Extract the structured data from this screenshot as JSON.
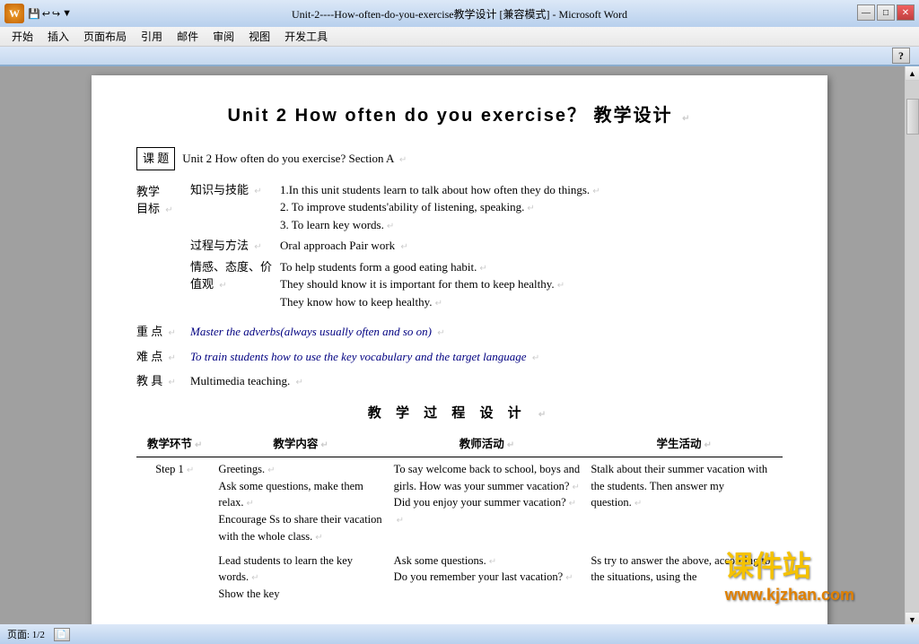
{
  "titlebar": {
    "title": "Unit-2----How-often-do-you-exercise教学设计 [兼容模式] - Microsoft Word",
    "minimize": "—",
    "maximize": "□",
    "close": "✕"
  },
  "quickaccess": {
    "save": "💾",
    "undo": "↩",
    "redo": "↪",
    "dropdown": "▼"
  },
  "menubar": {
    "items": [
      "开始",
      "插入",
      "页面布局",
      "引用",
      "邮件",
      "审阅",
      "视图",
      "开发工具"
    ]
  },
  "document": {
    "title": "Unit 2    How often do you exercise？  教学设计",
    "keti_label": "课  题",
    "keti_content": "Unit 2   How often do you exercise? Section A",
    "jiaoxue_label": "教学\n目标",
    "zhishi_label": "知识与技能",
    "zhishi_items": [
      "1.In this unit students learn to talk about how often they do things.",
      "2. To improve students'ability of listening, speaking.",
      "3. To learn key words."
    ],
    "guocheng_label": "过程与方法",
    "guocheng_content": "Oral approach Pair work",
    "qinggan_label": "情感、态度、价值观",
    "qinggan_items": [
      "To help students form a good eating habit.",
      "They should know it is important for them to keep healthy.",
      "They know how to keep healthy."
    ],
    "zhongdian_label": "重 点",
    "zhongdian_content": "Master the adverbs(always usually often and so on)",
    "nandian_label": "难 点",
    "nandian_content": "To train students how to use the key vocabulary and the target language",
    "jiaoju_label": "教   具",
    "jiaoju_content": "Multimedia teaching.",
    "process_title": "教 学 过 程 设 计",
    "table_headers": [
      "教学环节",
      "教学内容",
      "教师活动",
      "学生活动"
    ],
    "table_rows": [
      {
        "step": "Step 1",
        "content": "Greetings.\nAsk some questions, make them relax.\nEncourage Ss to share their vacation with the whole class.",
        "teacher": "To say welcome back to school, boys and girls. How was your summer vacation?\nDid you enjoy your summer vacation?",
        "student": "Stalk about their summer vacation with the students. Then answer my question."
      },
      {
        "step": "",
        "content": "Lead students to learn the key words.\nShow the key",
        "teacher": "Ask some questions.\nDo you remember your last vacation?",
        "student": "Ss try to answer the above, according to the situations, using the"
      }
    ]
  },
  "statusbar": {
    "page_info": "页面: 1/2",
    "page_icon": "📄"
  },
  "watermark": {
    "line1": "课件站",
    "line2": "www.kjzhan.com"
  }
}
